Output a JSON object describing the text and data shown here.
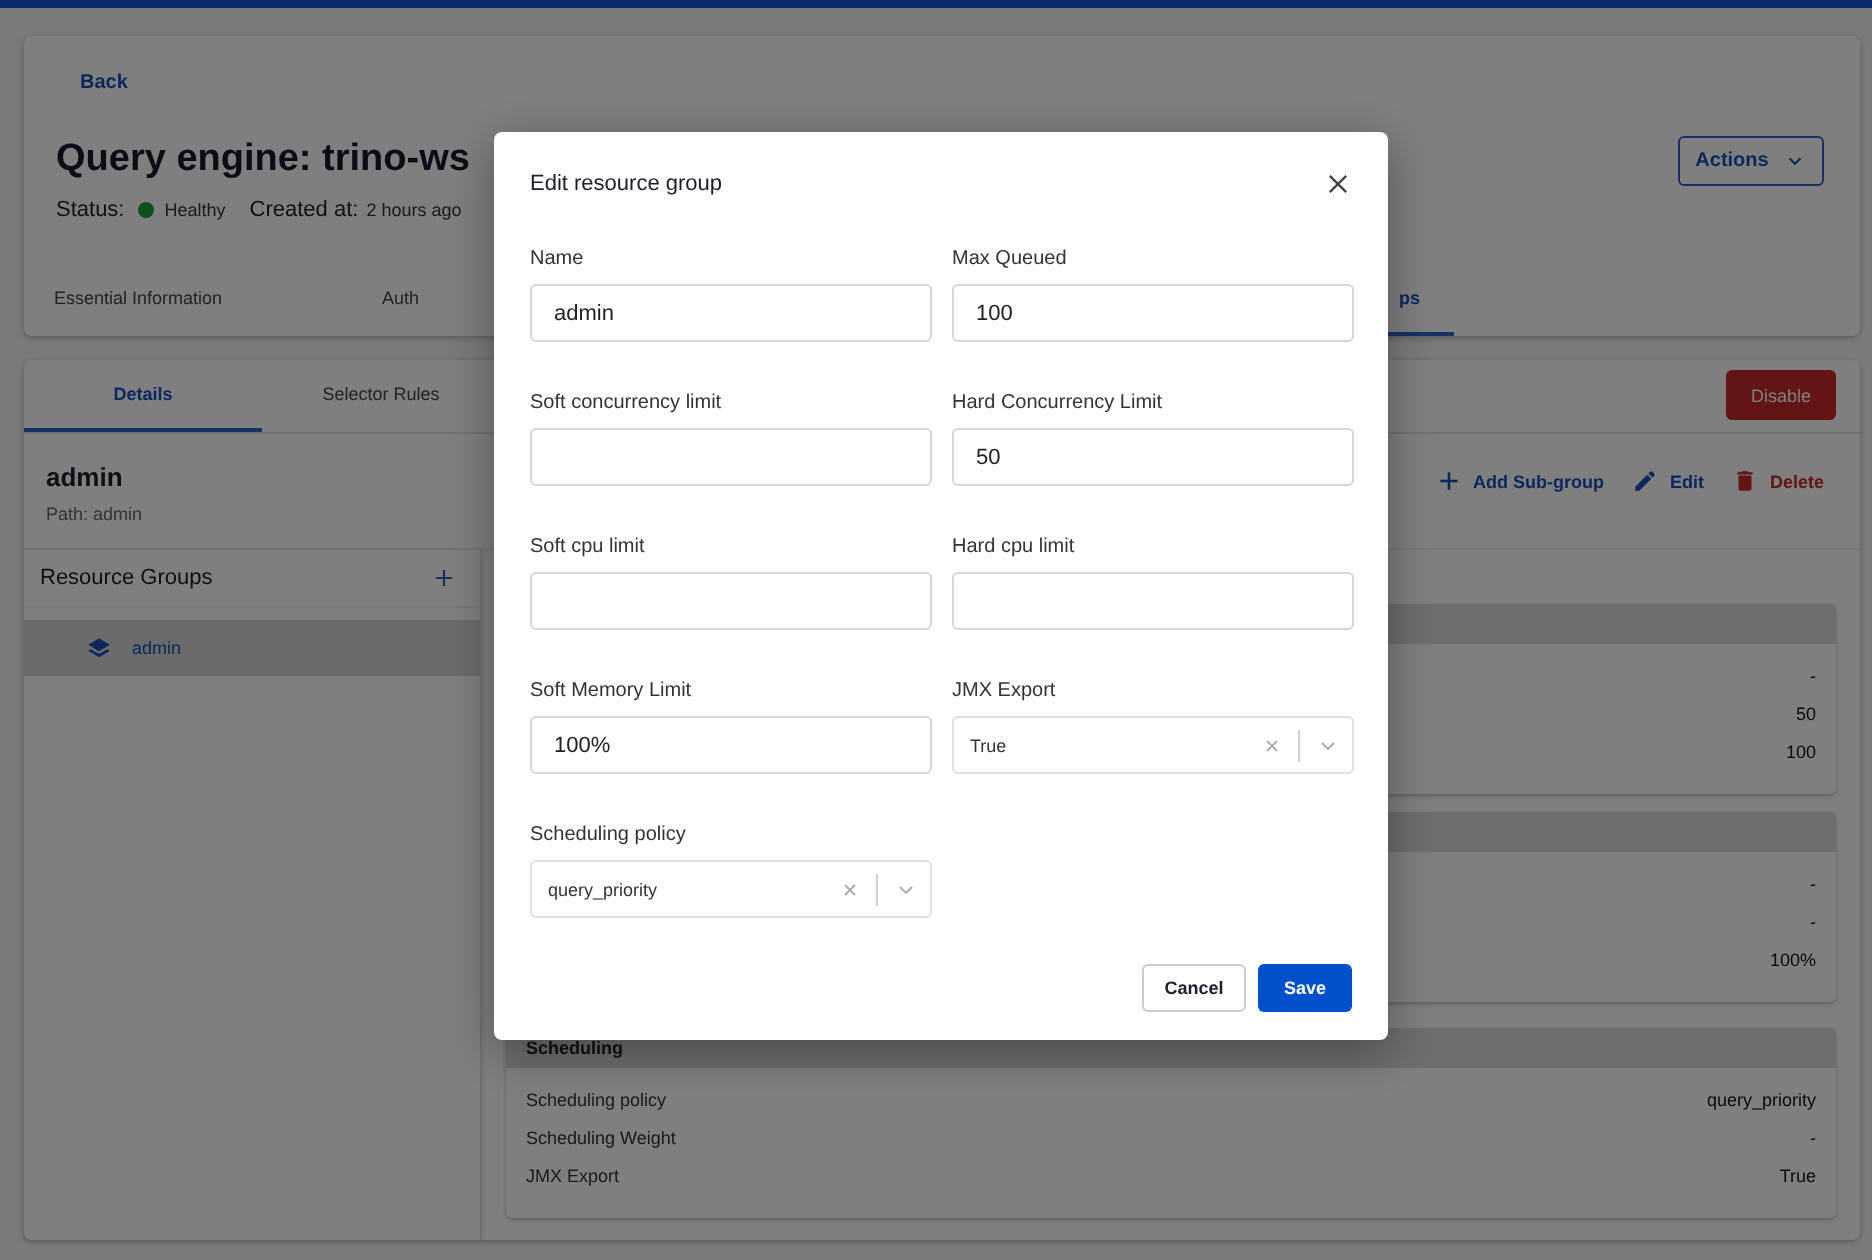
{
  "header": {
    "back_link": "Back",
    "title": "Query engine: trino-ws",
    "status_label": "Status:",
    "status_value": "Healthy",
    "created_label": "Created at:",
    "created_value": "2 hours ago",
    "actions_button": "Actions",
    "tabs": [
      {
        "label": "Essential Information",
        "selected": false
      },
      {
        "label": "Auth",
        "selected": false
      },
      {
        "label": "ps",
        "selected": true
      }
    ]
  },
  "detail": {
    "tabs": [
      {
        "label": "Details",
        "selected": true
      },
      {
        "label": "Selector Rules",
        "selected": false
      }
    ],
    "disable_button": "Disable",
    "group_name": "admin",
    "group_path": "Path: admin",
    "actions": [
      {
        "kind": "add",
        "label": "Add Sub-group"
      },
      {
        "kind": "edit",
        "label": "Edit"
      },
      {
        "kind": "delete",
        "label": "Delete"
      }
    ],
    "tree": {
      "title": "Resource Groups",
      "items": [
        {
          "label": "admin",
          "selected": true
        }
      ]
    },
    "panels": [
      {
        "rows": [
          {
            "value": "-"
          },
          {
            "value": "50"
          },
          {
            "value": "100"
          }
        ]
      },
      {
        "rows": [
          {
            "value": "-"
          },
          {
            "value": "-"
          },
          {
            "value": "100%"
          }
        ]
      },
      {
        "title": "Scheduling",
        "rows": [
          {
            "label": "Scheduling policy",
            "value": "query_priority"
          },
          {
            "label": "Scheduling Weight",
            "value": "-"
          },
          {
            "label": "JMX Export",
            "value": "True"
          }
        ]
      }
    ]
  },
  "dialog": {
    "title": "Edit resource group",
    "fields": [
      {
        "kind": "text",
        "label": "Name",
        "value": "admin"
      },
      {
        "kind": "text",
        "label": "Max Queued",
        "value": "100"
      },
      {
        "kind": "text",
        "label": "Soft concurrency limit"
      },
      {
        "kind": "text",
        "label": "Hard Concurrency Limit",
        "value": "50"
      },
      {
        "kind": "text",
        "label": "Soft cpu limit"
      },
      {
        "kind": "text",
        "label": "Hard cpu limit"
      },
      {
        "kind": "text",
        "label": "Soft Memory Limit",
        "value": "100%"
      },
      {
        "kind": "select",
        "label": "JMX Export",
        "value": "True"
      },
      {
        "kind": "select",
        "label": "Scheduling policy",
        "value": "query_priority"
      }
    ],
    "buttons": [
      {
        "kind": "secondary",
        "label": "Cancel"
      },
      {
        "kind": "primary",
        "label": "Save"
      }
    ]
  }
}
